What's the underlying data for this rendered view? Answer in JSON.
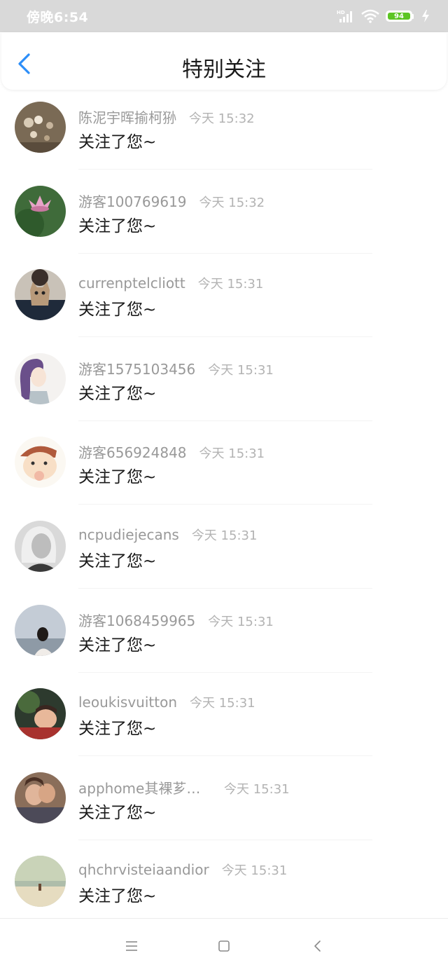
{
  "status_bar": {
    "time": "傍晚6:54",
    "network_label": "HD",
    "battery_level": "94",
    "icons": [
      "signal-icon",
      "wifi-icon",
      "battery-icon",
      "charging-icon"
    ]
  },
  "header": {
    "title": "特别关注",
    "back_icon": "chevron-left-icon",
    "accent_color": "#2c8ef8"
  },
  "list": {
    "items": [
      {
        "name": "陈泥宇晖揄柯狲",
        "time": "今天 15:32",
        "message": "关注了您~"
      },
      {
        "name": "游客100769619",
        "time": "今天 15:32",
        "message": "关注了您~"
      },
      {
        "name": "currenptelcliott",
        "time": "今天 15:31",
        "message": "关注了您~"
      },
      {
        "name": "游客1575103456",
        "time": "今天 15:31",
        "message": "关注了您~"
      },
      {
        "name": "游客656924848",
        "time": "今天 15:31",
        "message": "关注了您~"
      },
      {
        "name": "ncpudiejecans",
        "time": "今天 15:31",
        "message": "关注了您~"
      },
      {
        "name": "游客1068459965",
        "time": "今天 15:31",
        "message": "关注了您~"
      },
      {
        "name": "leoukisvuitton",
        "time": "今天 15:31",
        "message": "关注了您~"
      },
      {
        "name": "apphome其裸芗他...",
        "time": "今天 15:31",
        "message": "关注了您~"
      },
      {
        "name": "qhchrvisteiaandior",
        "time": "今天 15:31",
        "message": "关注了您~"
      }
    ]
  },
  "nav_bar": {
    "icons": [
      "menu-icon",
      "home-square-icon",
      "back-triangle-icon"
    ]
  }
}
